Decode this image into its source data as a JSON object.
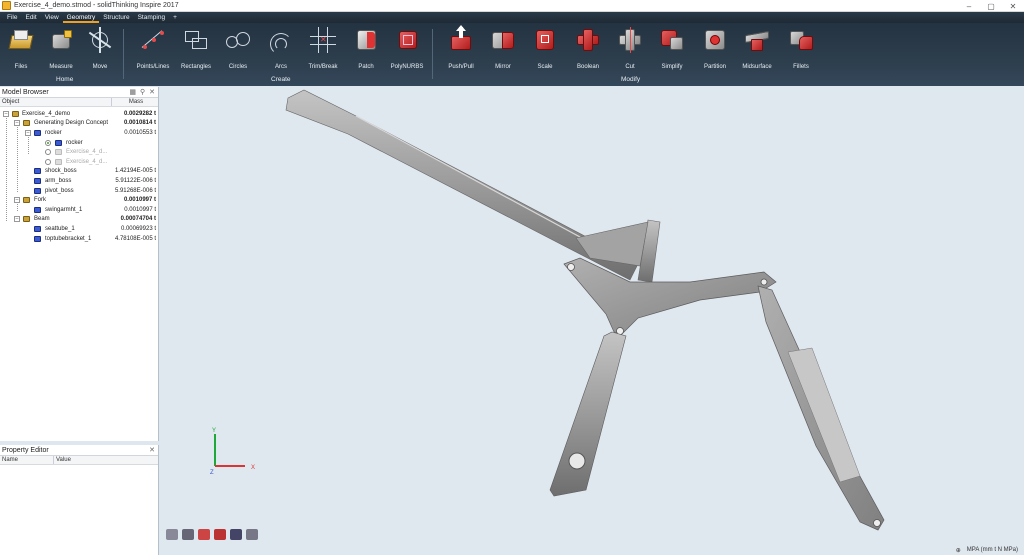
{
  "window": {
    "title": "Exercise_4_demo.stmod - solidThinking Inspire 2017",
    "controls": [
      "–",
      "▢",
      "✕"
    ]
  },
  "menu": [
    "File",
    "Edit",
    "View",
    "Geometry",
    "Structure",
    "Stamping",
    "+"
  ],
  "ribbon": {
    "home_tools": [
      "Files",
      "Measure",
      "Move"
    ],
    "home_group": "Home",
    "create_tools": [
      "Points/Lines",
      "Rectangles",
      "Circles",
      "Arcs",
      "Trim/Break",
      "Patch",
      "PolyNURBS"
    ],
    "create_group": "Create",
    "modify_tools": [
      "Push/Pull",
      "Mirror",
      "Scale",
      "Boolean",
      "Cut",
      "Simplify",
      "Partition",
      "Midsurface",
      "Fillets"
    ],
    "modify_group": "Modify"
  },
  "model_browser": {
    "title": "Model Browser",
    "columns": [
      "Object",
      "Mass"
    ],
    "rows": [
      {
        "name": "Exercise_4_demo",
        "mass": "0.0029282 t",
        "bold": true
      },
      {
        "name": "Generating Design Concept",
        "mass": "0.0010814 t",
        "bold": true
      },
      {
        "name": "rocker",
        "mass": "0.0010553 t",
        "bold": false
      },
      {
        "name": "rocker",
        "mass": "",
        "bold": false
      },
      {
        "name": "Exercise_4_d...",
        "mass": "",
        "bold": false
      },
      {
        "name": "Exercise_4_d...",
        "mass": "",
        "bold": false
      },
      {
        "name": "shock_boss",
        "mass": "1.42194E-005 t",
        "bold": false
      },
      {
        "name": "arm_boss",
        "mass": "5.91122E-006 t",
        "bold": false
      },
      {
        "name": "pivot_boss",
        "mass": "5.91268E-006 t",
        "bold": false
      },
      {
        "name": "Fork",
        "mass": "0.0010997 t",
        "bold": true
      },
      {
        "name": "swingarmht_1",
        "mass": "0.0010997 t",
        "bold": false
      },
      {
        "name": "Beam",
        "mass": "0.00074704 t",
        "bold": true
      },
      {
        "name": "seattube_1",
        "mass": "0.00069923 t",
        "bold": false
      },
      {
        "name": "toptubebracket_1",
        "mass": "4.78108E-005 t",
        "bold": false
      }
    ]
  },
  "property_editor": {
    "title": "Property Editor",
    "columns": [
      "Name",
      "Value"
    ]
  },
  "axis_labels": {
    "x": "X",
    "y": "Y",
    "z": "Z"
  },
  "status": {
    "units": "MPA (mm t N MPa)"
  },
  "colors": {
    "accent": "#f0a020",
    "ribbon": "#2d3e4d",
    "viewport": "#dfe7ef",
    "model": "#9a9a9a"
  }
}
